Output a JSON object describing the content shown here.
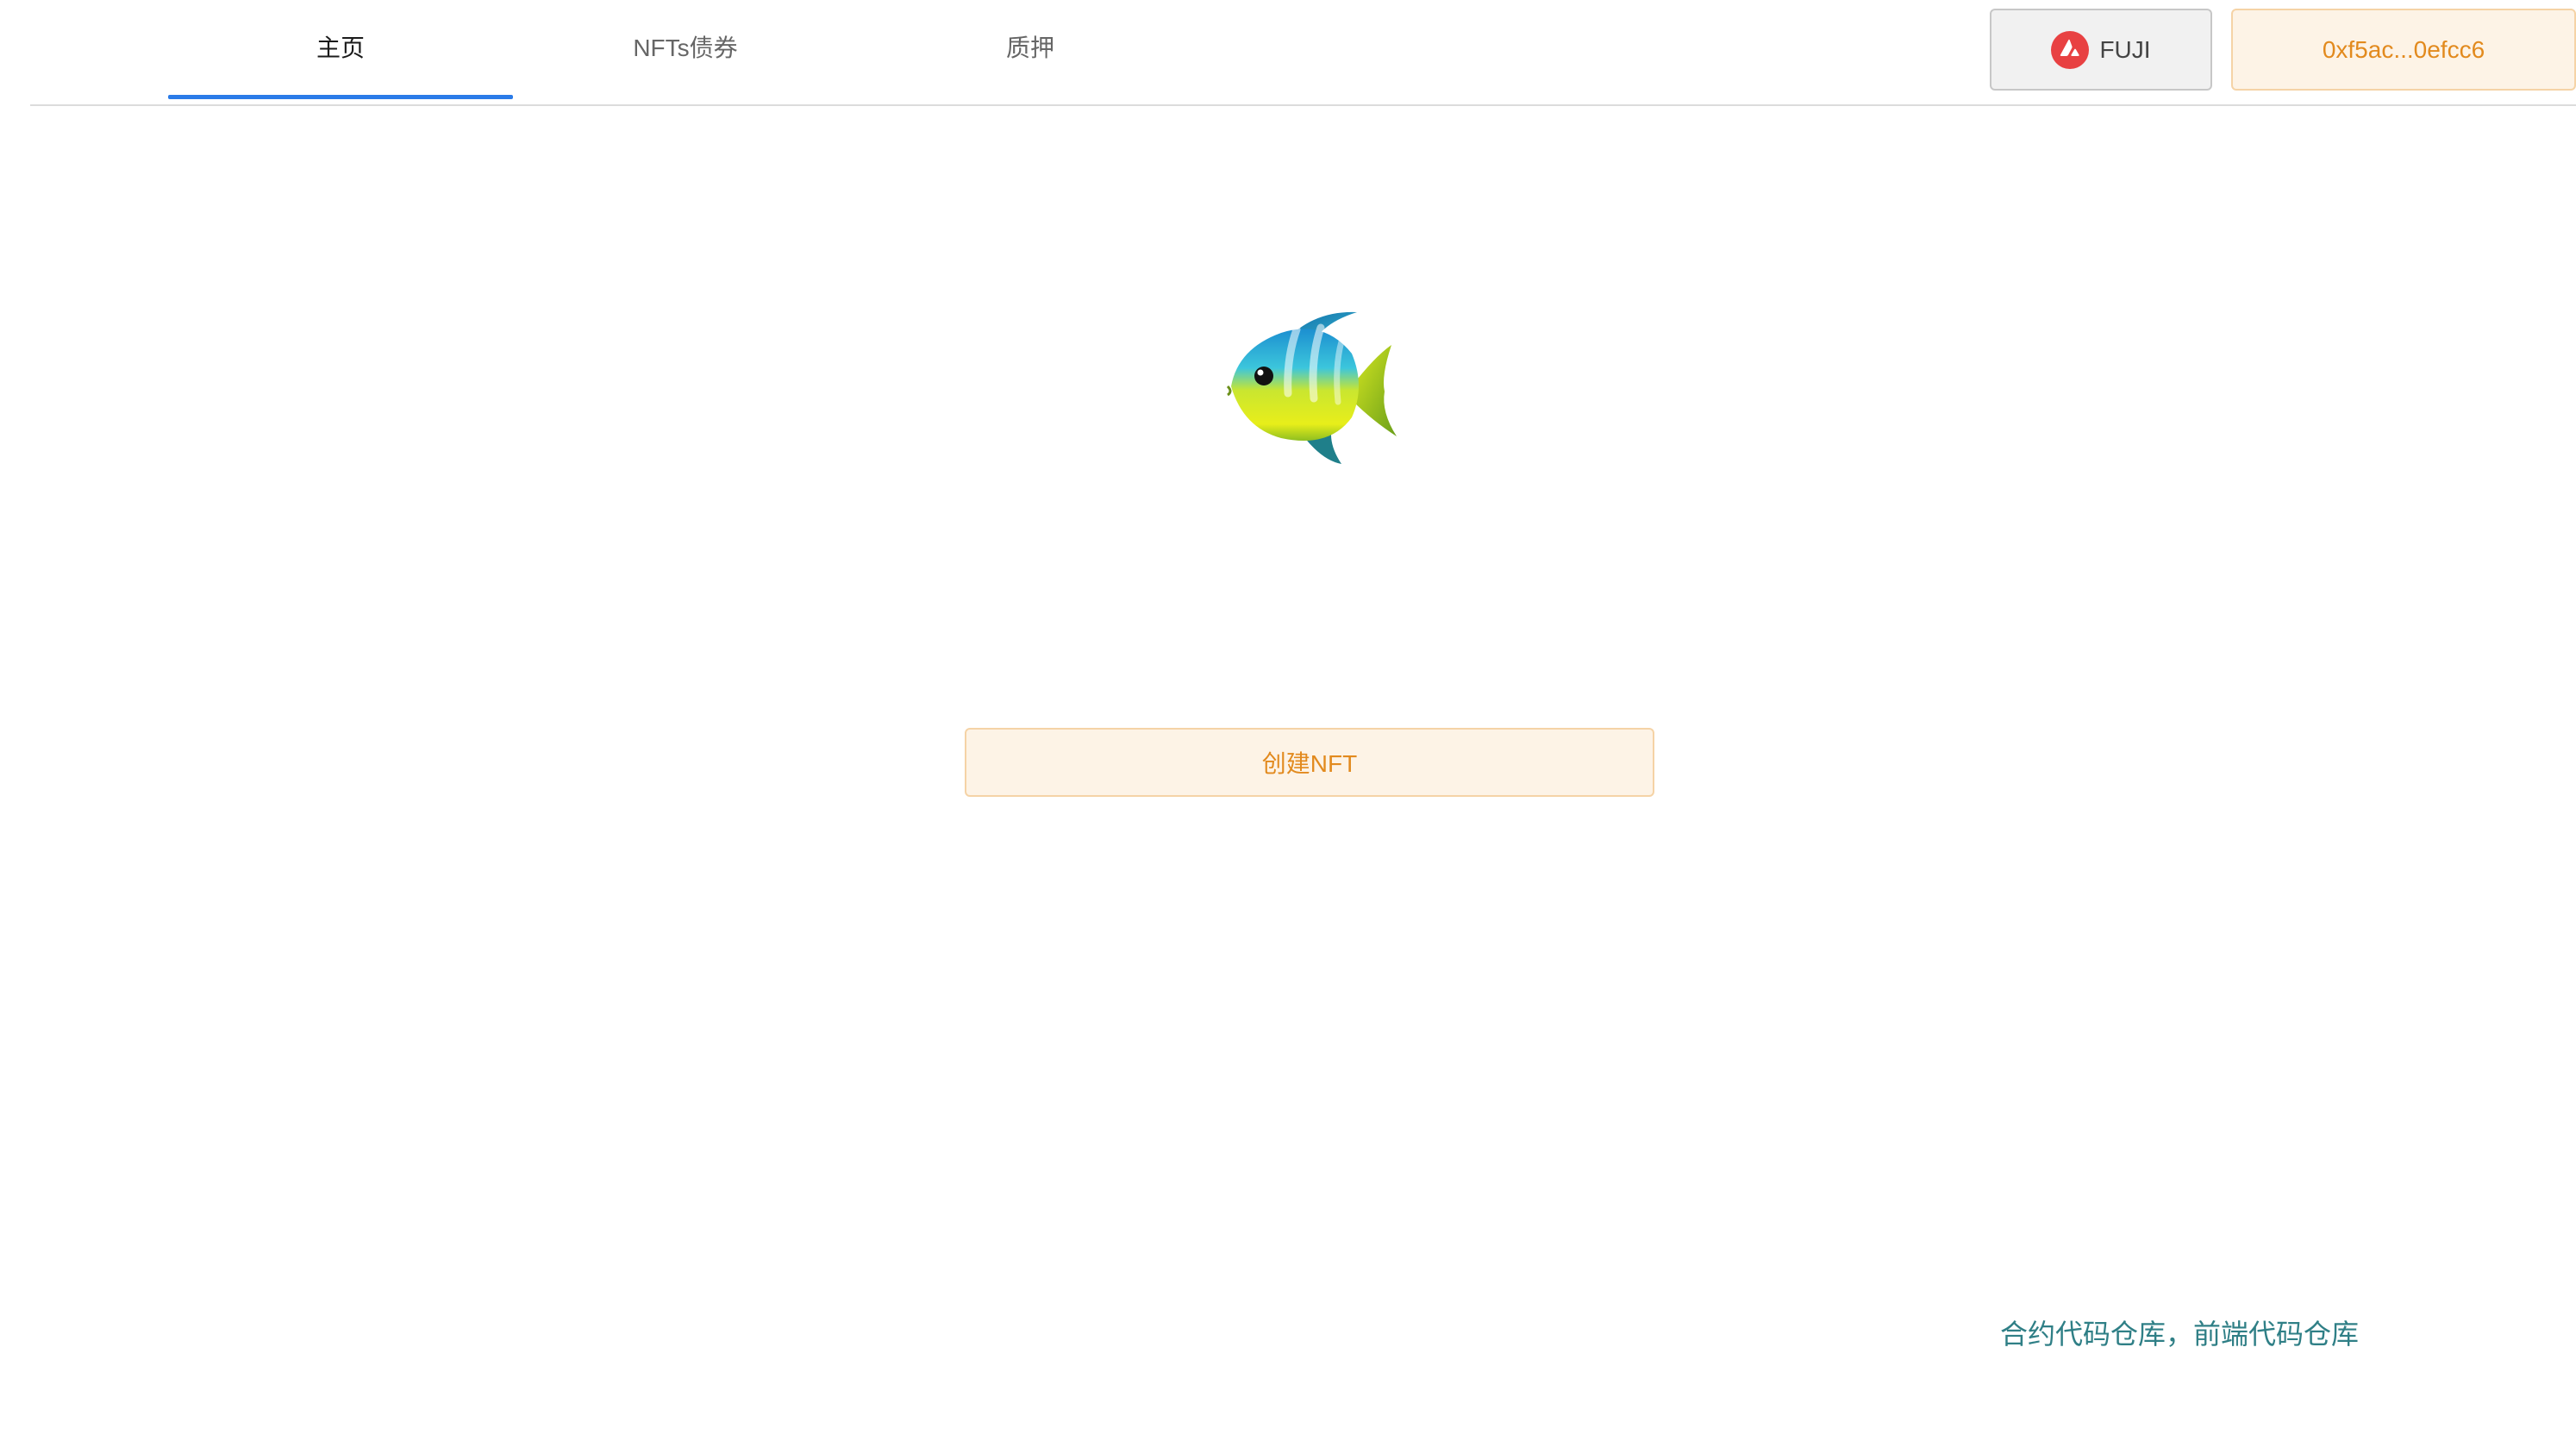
{
  "nav": {
    "tabs": [
      {
        "label": "主页",
        "active": true
      },
      {
        "label": "NFTs债券",
        "active": false
      },
      {
        "label": "质押",
        "active": false
      }
    ]
  },
  "network": {
    "label": "FUJI",
    "icon": "avalanche-icon"
  },
  "wallet": {
    "address": "0xf5ac...0efcc6"
  },
  "main": {
    "image": "tropical-fish-icon",
    "create_button": "创建NFT"
  },
  "footer": {
    "contract_link": "合约代码仓库",
    "separator": "，",
    "frontend_link": "前端代码仓库"
  },
  "colors": {
    "accent_tab_underline": "#2a7be8",
    "orange_text": "#e28a1e",
    "orange_bg": "#fdf3e6",
    "link_teal": "#2f7f86",
    "avalanche_red": "#e84142"
  }
}
